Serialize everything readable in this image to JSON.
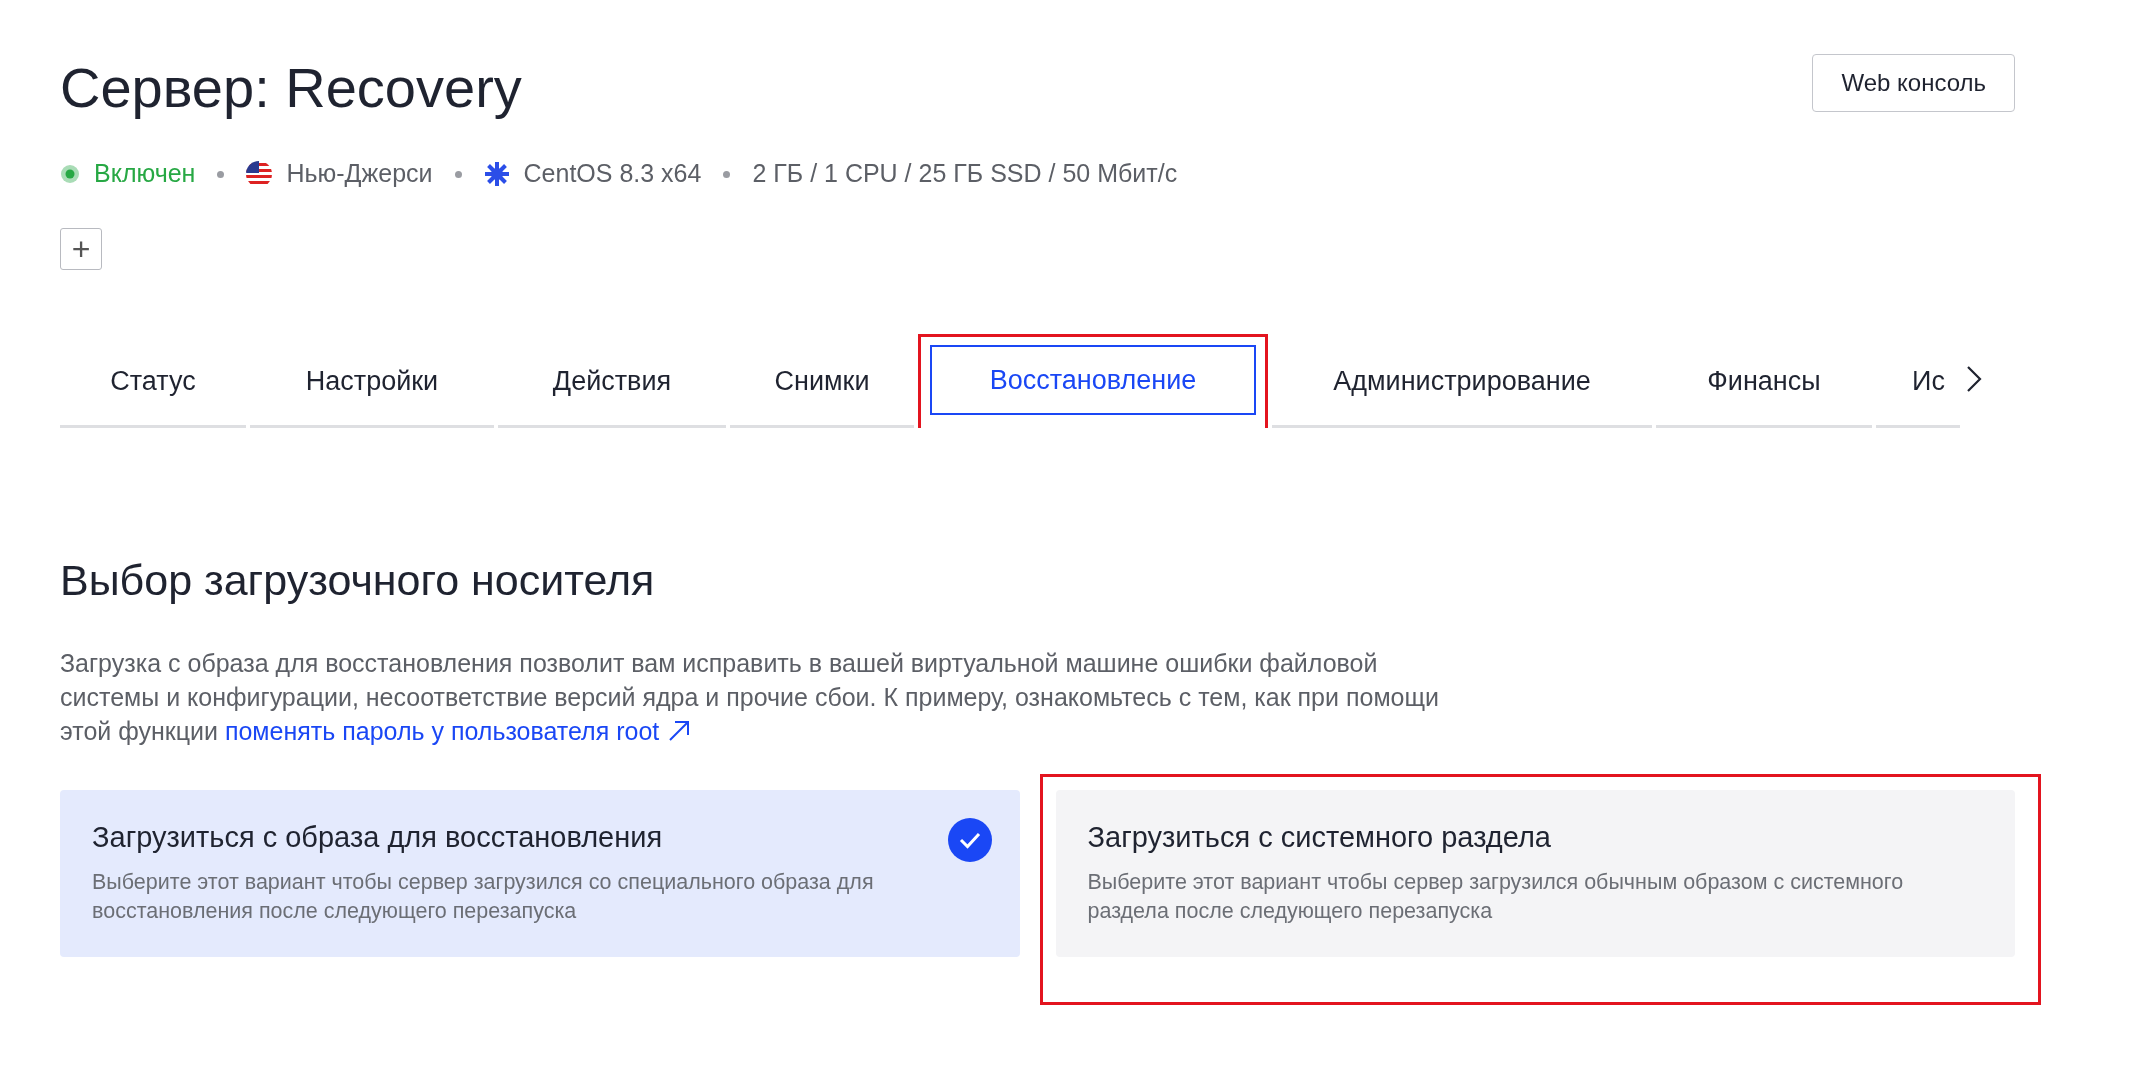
{
  "header": {
    "title": "Сервер: Recovery",
    "console_button": "Web консоль"
  },
  "meta": [
    {
      "kind": "status",
      "text": "Включен"
    },
    {
      "kind": "flag",
      "text": "Нью-Джерси"
    },
    {
      "kind": "os",
      "text": "CentOS 8.3 x64"
    },
    {
      "kind": "plan",
      "text": "2 ГБ / 1 CPU / 25 ГБ SSD / 50 Мбит/с"
    }
  ],
  "add_button": "+",
  "tabs": [
    {
      "label": "Статус",
      "selected": false,
      "highlighted": false
    },
    {
      "label": "Настройки",
      "selected": false,
      "highlighted": false
    },
    {
      "label": "Действия",
      "selected": false,
      "highlighted": false
    },
    {
      "label": "Снимки",
      "selected": false,
      "highlighted": false
    },
    {
      "label": "Восстановление",
      "selected": true,
      "highlighted": true
    },
    {
      "label": "Администрирование",
      "selected": false,
      "highlighted": false
    },
    {
      "label": "Финансы",
      "selected": false,
      "highlighted": false
    },
    {
      "label": "Ис",
      "selected": false,
      "highlighted": false
    }
  ],
  "section": {
    "title": "Выбор загрузочного носителя",
    "description": "Загрузка с образа для восстановления позволит вам исправить в вашей виртуальной машине ошибки файловой системы и конфигурации, несоответствие версий ядра и прочие сбои. К примеру, ознакомьтесь с тем, как при помощи этой функции",
    "link": "поменять пароль у пользователя root"
  },
  "options": [
    {
      "title": "Загрузиться с образа для восстановления",
      "text": "Выберите этот вариант чтобы сервер загрузился со специального образа для восстановления после следующего перезапуска",
      "selected": true,
      "highlighted": false
    },
    {
      "title": "Загрузиться с системного раздела",
      "text": "Выберите этот вариант чтобы сервер загрузился обычным образом с системного раздела после следующего перезапуска",
      "selected": false,
      "highlighted": true
    }
  ]
}
